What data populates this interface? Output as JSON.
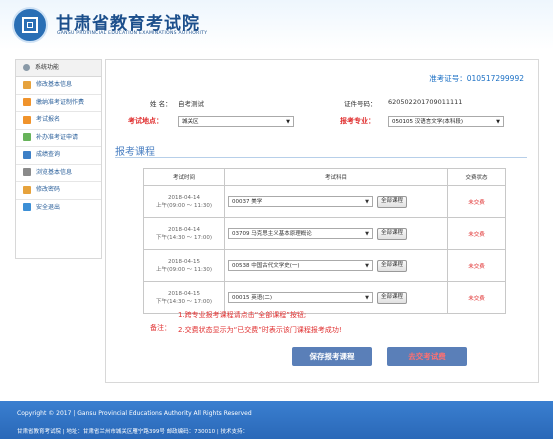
{
  "header": {
    "title": "甘肃省教育考试院",
    "subtitle": "GANSU PROVINCIAL EDUCATION EXAMINATIONS AUTHORITY"
  },
  "sidebar": {
    "heading": "系统功能",
    "items": [
      {
        "label": "修改基本信息",
        "icon": "edit-icon",
        "color": "#e6a23c"
      },
      {
        "label": "缴纳准考证制作费",
        "icon": "payment-icon",
        "color": "#f0932b"
      },
      {
        "label": "考试报名",
        "icon": "register-icon",
        "color": "#f0932b"
      },
      {
        "label": "补办准考证申请",
        "icon": "card-icon",
        "color": "#67b35a"
      },
      {
        "label": "成绩查询",
        "icon": "grades-icon",
        "color": "#3c7fc6"
      },
      {
        "label": "浏览基本信息",
        "icon": "browse-icon",
        "color": "#8a8a8a"
      },
      {
        "label": "修改密码",
        "icon": "key-icon",
        "color": "#e6a23c"
      },
      {
        "label": "安全退出",
        "icon": "exit-icon",
        "color": "#3c8fd6"
      }
    ]
  },
  "main": {
    "ticket_label": "准考证号：",
    "ticket_number": "010517299992",
    "name_label": "姓  名：",
    "name_value": "自考测试",
    "id_label": "证件号码：",
    "id_value": "620502201709011111",
    "exam_site_label": "考试地点：",
    "exam_site_value": "城关区",
    "major_label": "报考专业：",
    "major_value": "050105 汉语言文学(本科段)",
    "section_title": "报考课程",
    "table_headers": [
      "考试时间",
      "考试科目",
      "交费状态"
    ],
    "all_courses_label": "全部课程",
    "courses": [
      {
        "date": "2018-04-14",
        "time": "上午(09:00 ～ 11:30)",
        "course": "00037 美学",
        "status": "未交费"
      },
      {
        "date": "2018-04-14",
        "time": "下午(14:30 ～ 17:00)",
        "course": "03709 马克思主义基本原理概论",
        "status": "未交费"
      },
      {
        "date": "2018-04-15",
        "time": "上午(09:00 ～ 11:30)",
        "course": "00538 中国古代文学史(一)",
        "status": "未交费"
      },
      {
        "date": "2018-04-15",
        "time": "下午(14:30 ～ 17:00)",
        "course": "00015 英语(二)",
        "status": "未交费"
      }
    ],
    "notes_label": "备注：",
    "notes": [
      "1.跨专业报考课程请点击“全部课程”按钮;",
      "2.交费状态显示为“已交费”时表示该门课程报考成功!"
    ],
    "save_button": "保存报考课程",
    "submit_button": "去交考试费"
  },
  "footer": {
    "copyright": "Copyright © 2017 | Gansu Provincial Educations Authority All Rights Reserved",
    "info": "甘肃省教育考试院 | 地址：甘肃省兰州市城关区雁宁路399号 邮政编码：730010 | 技术支持："
  }
}
